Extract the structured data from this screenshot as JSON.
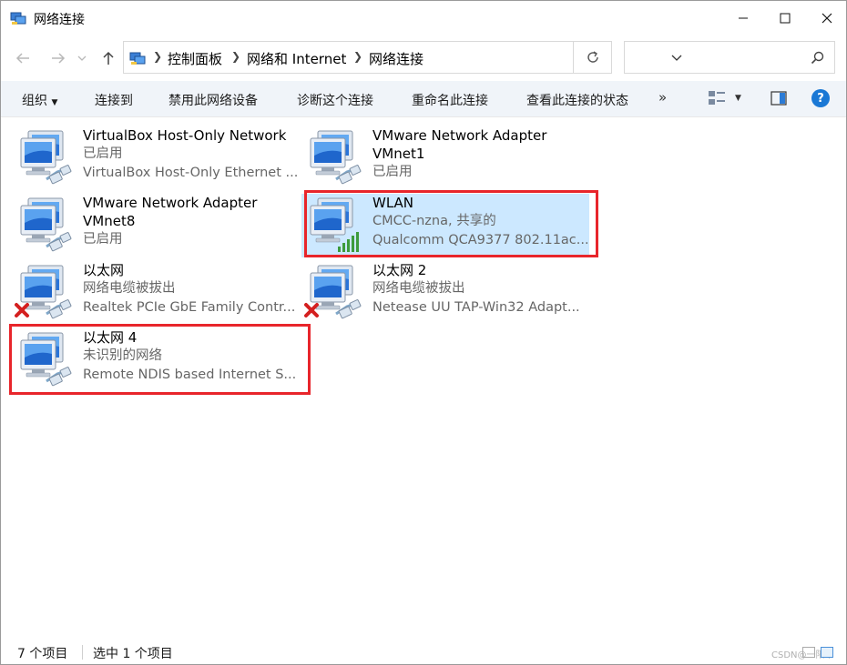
{
  "window": {
    "title": "网络连接"
  },
  "address": {
    "crumbs": [
      "控制面板",
      "网络和 Internet",
      "网络连接"
    ],
    "search_placeholder": ""
  },
  "toolbar": {
    "organize": "组织",
    "connect": "连接到",
    "disable": "禁用此网络设备",
    "diagnose": "诊断这个连接",
    "rename": "重命名此连接",
    "status": "查看此连接的状态",
    "more": "»",
    "help": "?"
  },
  "connections": [
    {
      "name": "VirtualBox Host-Only Network",
      "name2": "",
      "status": "已启用",
      "device": "VirtualBox Host-Only Ethernet ...",
      "type": "ethernet",
      "disconnected": false,
      "selected": false
    },
    {
      "name": "VMware Network Adapter",
      "name2": "VMnet1",
      "status": "已启用",
      "device": "",
      "type": "ethernet",
      "disconnected": false,
      "selected": false
    },
    {
      "name": "VMware Network Adapter",
      "name2": "VMnet8",
      "status": "已启用",
      "device": "",
      "type": "ethernet",
      "disconnected": false,
      "selected": false
    },
    {
      "name": "WLAN",
      "name2": "",
      "status": "CMCC-nzna, 共享的",
      "device": "Qualcomm QCA9377 802.11ac...",
      "type": "wifi",
      "disconnected": false,
      "selected": true
    },
    {
      "name": "以太网",
      "name2": "",
      "status": "网络电缆被拔出",
      "device": "Realtek PCIe GbE Family Contr...",
      "type": "ethernet",
      "disconnected": true,
      "selected": false
    },
    {
      "name": "以太网 2",
      "name2": "",
      "status": "网络电缆被拔出",
      "device": "Netease UU TAP-Win32 Adapt...",
      "type": "ethernet",
      "disconnected": true,
      "selected": false
    },
    {
      "name": "以太网 4",
      "name2": "",
      "status": "未识别的网络",
      "device": "Remote NDIS based Internet S...",
      "type": "ethernet",
      "disconnected": false,
      "selected": false
    }
  ],
  "statusbar": {
    "count": "7 个项目",
    "selection": "选中 1 个项目",
    "watermark": "CSDN@一阳下"
  },
  "colors": {
    "highlight_border": "#e8252b",
    "selection_bg": "#cce8ff",
    "toolbar_bg": "#f0f4f9",
    "accent": "#1a78d5"
  }
}
